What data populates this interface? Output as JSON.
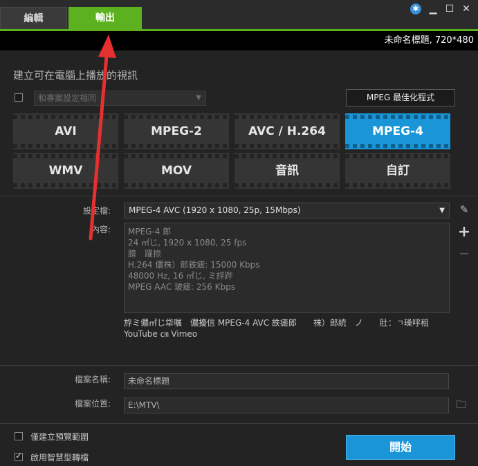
{
  "tabs": {
    "edit_label": "編輯",
    "output_label": "輸出"
  },
  "window": {
    "project_info": "未命名標題, 720*480"
  },
  "section": {
    "title": "建立可在電腦上播放的視訊",
    "match_placeholder": "和專案設定相同",
    "optimizer_label": "MPEG 最佳化程式"
  },
  "formats": [
    {
      "label": "AVI"
    },
    {
      "label": "MPEG-2"
    },
    {
      "label": "AVC / H.264"
    },
    {
      "label": "MPEG-4",
      "selected": true
    },
    {
      "label": "WMV"
    },
    {
      "label": "MOV"
    },
    {
      "label": "音訊"
    },
    {
      "label": "自訂"
    }
  ],
  "profile": {
    "label": "設定檔:",
    "value": "MPEG-4 AVC (1920 x 1080, 25p, 15Mbps)"
  },
  "content": {
    "label": "內容:",
    "lines": [
      "MPEG-4 郎",
      "24 ㎡じ, 1920 x 1080, 25 fps",
      "膀　躍捺",
      "H.264 儂祩）郎鉄瘧: 15000 Kbps",
      "48000 Hz, 16 ㎡じ, ミ評跸",
      "MPEG AAC 玻瘧: 256 Kbps"
    ]
  },
  "compat": {
    "line1": "斿ミ儂㎡じ牮嘱　儂擾信 MPEG-4 AVC 詄瘧郎　　祩）郎統　ノ　　肚：ㄱ璪呼租",
    "line2": "YouTube ㎝ Vimeo"
  },
  "file": {
    "name_label": "檔案名稱:",
    "name_value": "未命名標題",
    "location_label": "檔案位置:",
    "location_value": "E:\\MTV\\"
  },
  "options": {
    "preview_only_label": "僅建立預覽範圍",
    "smart_render_label": "啟用智慧型轉檔",
    "preview_only_checked": false,
    "smart_render_checked": true
  },
  "actions": {
    "start_label": "開始"
  },
  "colors": {
    "accent_green": "#5bb21e",
    "accent_blue": "#1a96d8",
    "annotation_red": "#e53030"
  }
}
